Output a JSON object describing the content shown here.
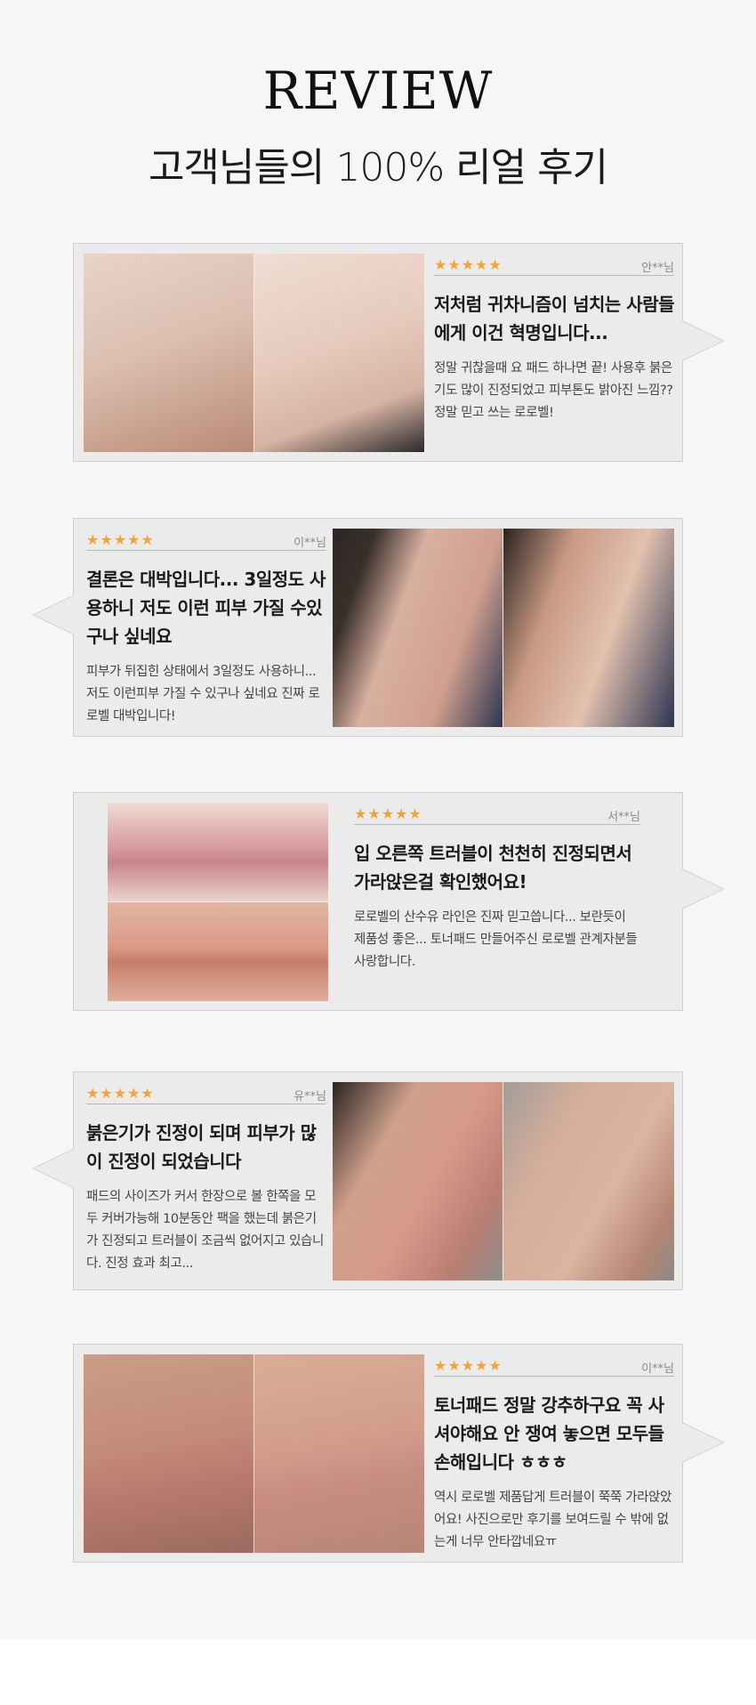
{
  "header": {
    "title": "REVIEW",
    "subtitle": "고객님들의 100% 리얼 후기"
  },
  "reviews": [
    {
      "stars": "★★★★★",
      "author": "안**님",
      "headline": "저처럼 귀차니즘이 넘치는 사람들에게 이건 혁명입니다...",
      "body": "정말 귀찮을때 요 패드 하나면 끝! 사용후 붉은기도 많이 진정되었고 피부톤도 밝아진 느낌?? 정말 믿고 쓰는 로로벨!"
    },
    {
      "stars": "★★★★★",
      "author": "이**님",
      "headline": "결론은 대박입니다... 3일정도 사용하니 저도 이런 피부 가질 수있구나 싶네요",
      "body": "피부가 뒤집힌 상태에서 3일정도 사용하니... 저도 이런피부 가질 수 있구나 싶네요 진짜 로로벨 대박입니다!"
    },
    {
      "stars": "★★★★★",
      "author": "서**님",
      "headline": "입 오른쪽 트러블이 천천히 진정되면서 가라앉은걸 확인했어요!",
      "body": "로로벨의 산수유 라인은 진짜 믿고씁니다... 보란듯이 제품성 좋은... 토너패드 만들어주신 로로벨 관계자분들 사랑합니다."
    },
    {
      "stars": "★★★★★",
      "author": "유**님",
      "headline": "붉은기가 진정이 되며 피부가 많이 진정이 되었습니다",
      "body": "패드의 사이즈가 커서 한장으로 볼 한쪽을 모두 커버가능해 10분동안 팩을 했는데 붉은기가 진정되고 트러블이 조금씩 없어지고 있습니다. 진정 효과 최고..."
    },
    {
      "stars": "★★★★★",
      "author": "이**님",
      "headline": "토너패드 정말 강추하구요 꼭 사셔야해요 안 쟁여 놓으면 모두들 손해입니다 ㅎㅎㅎ",
      "body": "역시 로로벨 제품답게 트러블이 쭉쭉 가라앉았어요! 사진으로만 후기를 보여드릴 수 밖에 없는게 너무 안타깝네요ㅠ"
    }
  ],
  "colors": {
    "star": "#f2a33a",
    "card_bg": "#ebebeb",
    "card_border": "#cfcfcf",
    "page_bg": "#f6f6f6"
  }
}
